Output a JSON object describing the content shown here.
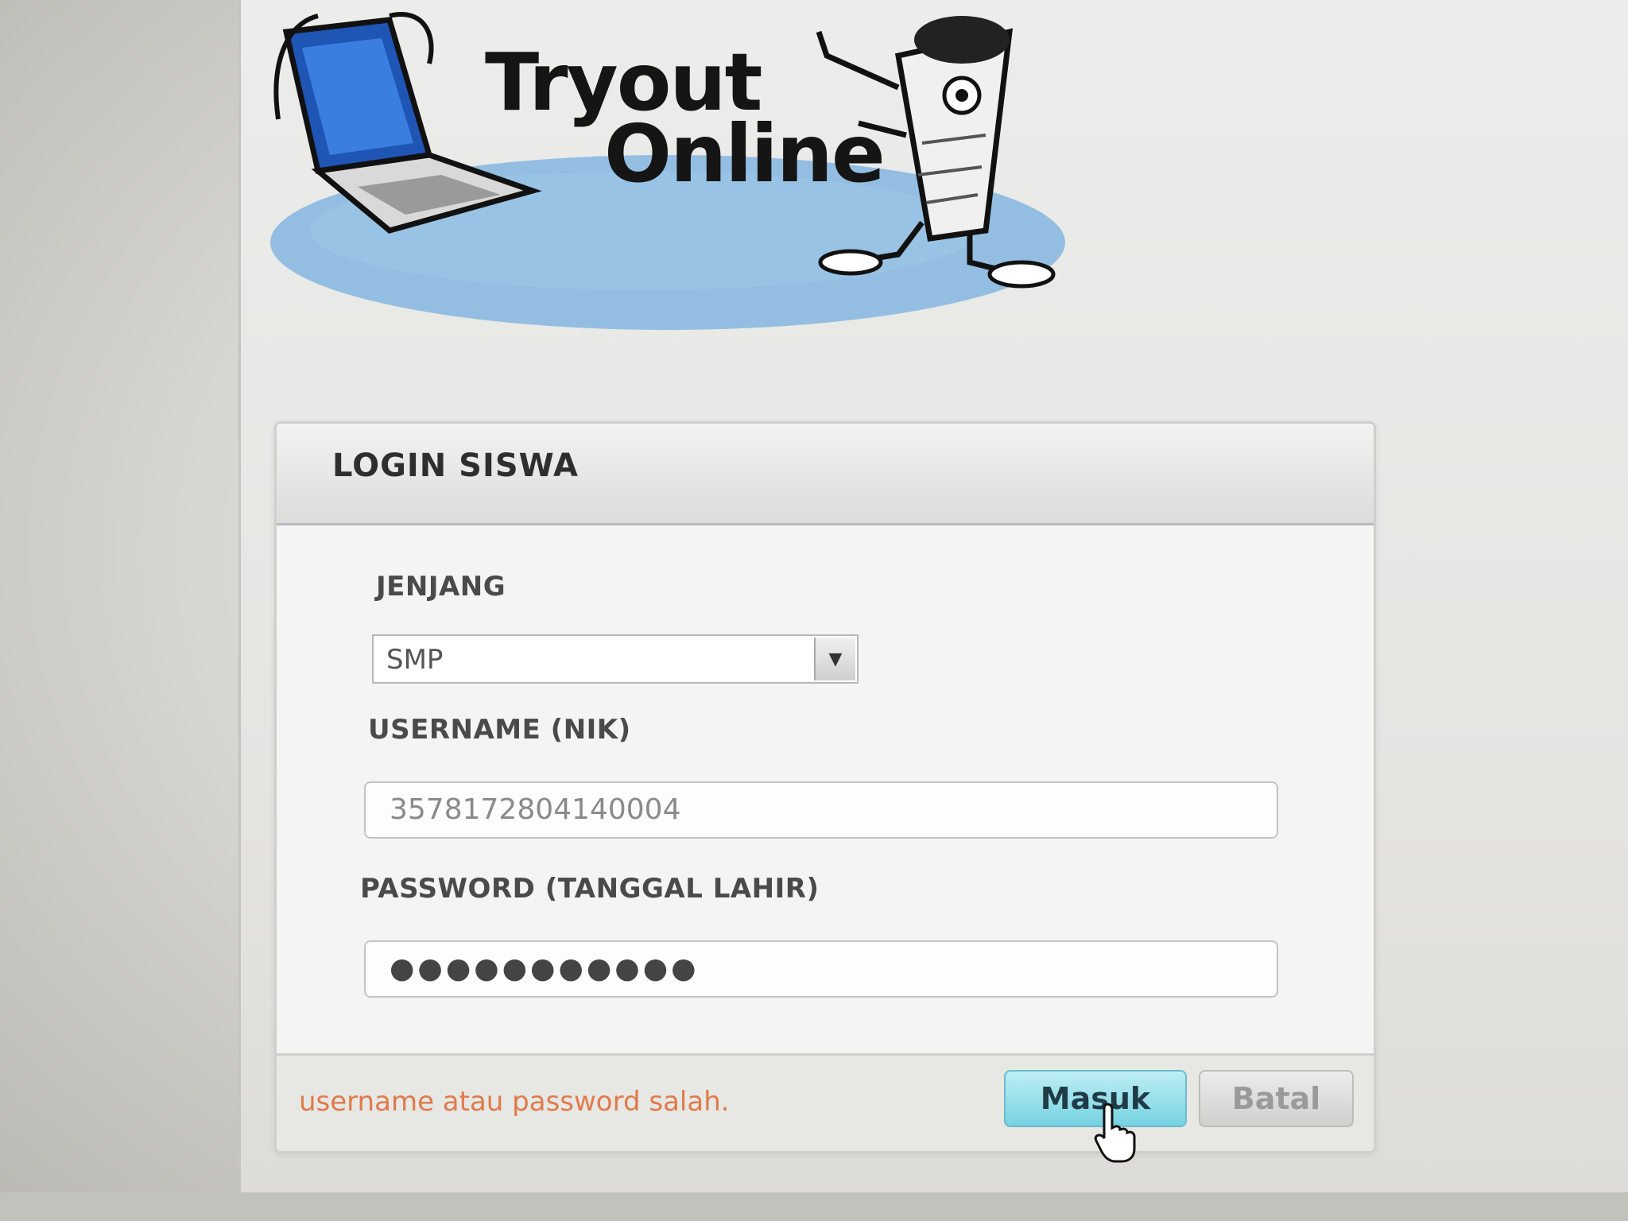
{
  "logo": {
    "line1": "Tryout",
    "line2": "Online"
  },
  "login": {
    "title": "LOGIN SISWA",
    "jenjang_label": "JENJANG",
    "jenjang_value": "SMP",
    "username_label": "USERNAME (NIK)",
    "username_value": "3578172804140004",
    "password_label": "PASSWORD (TANGGAL LAHIR)",
    "password_value": "●●●●●●●●●●●",
    "error": "username atau password salah.",
    "submit_label": "Masuk",
    "cancel_label": "Batal"
  },
  "icons": {
    "logo_laptop": "laptop-icon",
    "logo_mascot": "mascot-icon",
    "dropdown": "chevron-down-icon",
    "cursor": "hand-cursor-icon"
  },
  "colors": {
    "submit_button": "#75d2e1",
    "error_text": "#e07a4a",
    "logo_ellipse": "#7fb1dc"
  }
}
